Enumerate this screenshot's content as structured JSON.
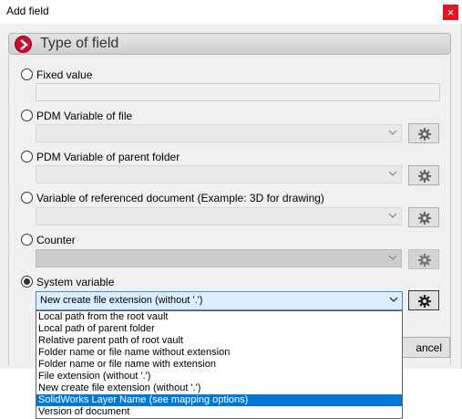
{
  "window": {
    "title": "Add field",
    "close_glyph": "×"
  },
  "group": {
    "title": "Type of field"
  },
  "options": [
    {
      "label": "Fixed value"
    },
    {
      "label": "PDM Variable of file"
    },
    {
      "label": "PDM Variable of parent folder"
    },
    {
      "label": "Variable of referenced document (Example: 3D for drawing)"
    },
    {
      "label": "Counter"
    },
    {
      "label": "System variable"
    }
  ],
  "selected_option": "System variable",
  "system_variable": {
    "value": "New create file extension (without '.')",
    "items": [
      "Local path from the root vault",
      "Local path of parent folder",
      "Relative parent path of root vault",
      "Folder name or file name without extension",
      "Folder name or file name with extension",
      "File extension (without '.')",
      "New create file extension (without '.')",
      "SolidWorks Layer Name (see mapping options)",
      "Version of document"
    ],
    "highlighted_item": "SolidWorks Layer Name (see mapping options)"
  },
  "footer": {
    "cancel_label": "ancel"
  },
  "icons": {
    "header": "chevron-right-icon",
    "settings": "gear-icon",
    "dropdown": "chevron-down-icon"
  },
  "colors": {
    "accent": "#c8102e",
    "selection": "#0078d7",
    "close": "#e81123"
  }
}
